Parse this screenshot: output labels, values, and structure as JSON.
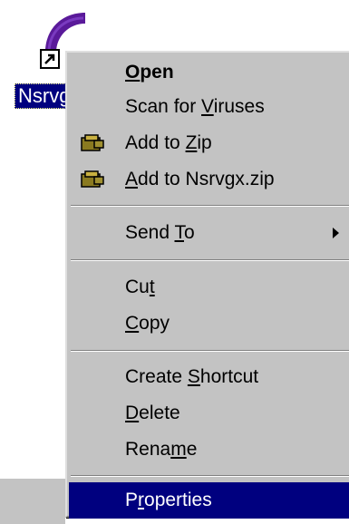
{
  "desktop": {
    "icon_label": "Nsrvg"
  },
  "menu": {
    "items": [
      {
        "label_pre": "",
        "label_u": "O",
        "label_post": "pen"
      },
      {
        "label_pre": "Scan for ",
        "label_u": "V",
        "label_post": "iruses"
      },
      {
        "label_pre": "Add to ",
        "label_u": "Z",
        "label_post": "ip"
      },
      {
        "label_pre": "",
        "label_u": "A",
        "label_post": "dd to Nsrvgx.zip"
      },
      {
        "label_pre": "Send ",
        "label_u": "T",
        "label_post": "o"
      },
      {
        "label_pre": "Cu",
        "label_u": "t",
        "label_post": ""
      },
      {
        "label_pre": "",
        "label_u": "C",
        "label_post": "opy"
      },
      {
        "label_pre": "Create ",
        "label_u": "S",
        "label_post": "hortcut"
      },
      {
        "label_pre": "",
        "label_u": "D",
        "label_post": "elete"
      },
      {
        "label_pre": "Rena",
        "label_u": "m",
        "label_post": "e"
      },
      {
        "label_pre": "P",
        "label_u": "r",
        "label_post": "operties"
      }
    ]
  },
  "colors": {
    "menu_bg": "#c3c3c3",
    "selection": "#00007f",
    "icon_purple": "#5a1a9a"
  }
}
